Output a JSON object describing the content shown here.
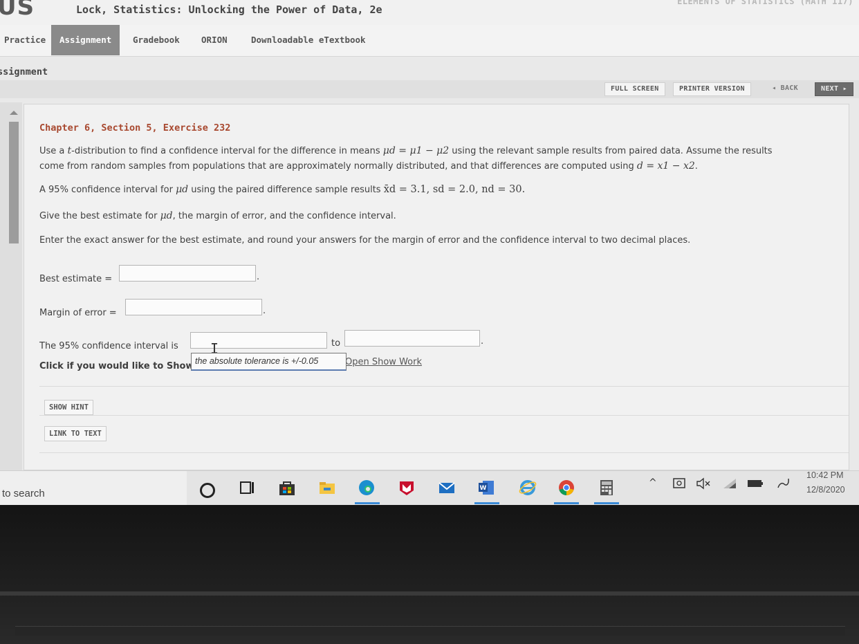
{
  "header": {
    "brand": "US",
    "book_title": "Lock, Statistics: Unlocking the Power of Data, 2e",
    "course_title": "ELEMENTS OF STATISTICS (MATH 117)"
  },
  "nav": {
    "tabs": [
      {
        "label": "Practice",
        "active": false
      },
      {
        "label": "Assignment",
        "active": true
      },
      {
        "label": "Gradebook",
        "active": false
      },
      {
        "label": "ORION",
        "active": false
      },
      {
        "label": "Downloadable eTextbook",
        "active": false
      }
    ]
  },
  "page": {
    "title": "ssignment",
    "toolbar": {
      "full_screen": "FULL SCREEN",
      "printer_version": "PRINTER VERSION",
      "back": "◂ BACK",
      "next": "NEXT ▸"
    }
  },
  "exercise": {
    "title": "Chapter 6, Section 5, Exercise 232",
    "intro": {
      "p1": "Use a ",
      "t": "t",
      "p2": "-distribution to find a confidence interval for the difference in means ",
      "eq1": "μd = μ1 − μ2",
      "p3": " using the relevant sample results from paired data. Assume the results",
      "line2": "come from random samples from populations that are approximately normally distributed, and that differences are computed using ",
      "eq2": "d = x1 − x2",
      "end": "."
    },
    "ci_line": {
      "p1": "A 95% confidence interval for ",
      "mu": "μd",
      "p2": " using the paired difference sample results ",
      "stats": "x̄d = 3.1, sd = 2.0, nd = 30."
    },
    "give_line": {
      "p1": "Give the best estimate for ",
      "mu": "μd",
      "p2": ", the margin of error, and the confidence interval."
    },
    "instructions": "Enter the exact answer for the best estimate, and round your answers for the margin of error and the confidence interval to two decimal places.",
    "best_estimate_label": "Best estimate =",
    "best_estimate_value": "",
    "margin_label": "Margin of error =",
    "margin_value": "",
    "interval_label": "The 95% confidence interval is",
    "interval_to": "to",
    "interval_lower": "",
    "interval_upper": "",
    "period": ".",
    "tooltip": "the absolute tolerance is +/-0.05",
    "show_work_label": "Click if you would like to Show Work for this question:",
    "show_work_link": "Open Show Work",
    "hint_button": "SHOW HINT",
    "link_button": "LINK TO TEXT"
  },
  "taskbar": {
    "search_text": "to search",
    "icons": [
      "cortana-icon",
      "task-view-icon",
      "store-icon",
      "file-explorer-icon",
      "edge-icon",
      "mcafee-icon",
      "mail-icon",
      "word-icon",
      "internet-explorer-icon",
      "chrome-icon",
      "calculator-icon"
    ],
    "time": "10:42 PM",
    "date": "12/8/2020"
  },
  "colors": {
    "accent_title": "#a8482f",
    "active_tab": "#8a8a8a",
    "next_button": "#6c6c6c"
  }
}
